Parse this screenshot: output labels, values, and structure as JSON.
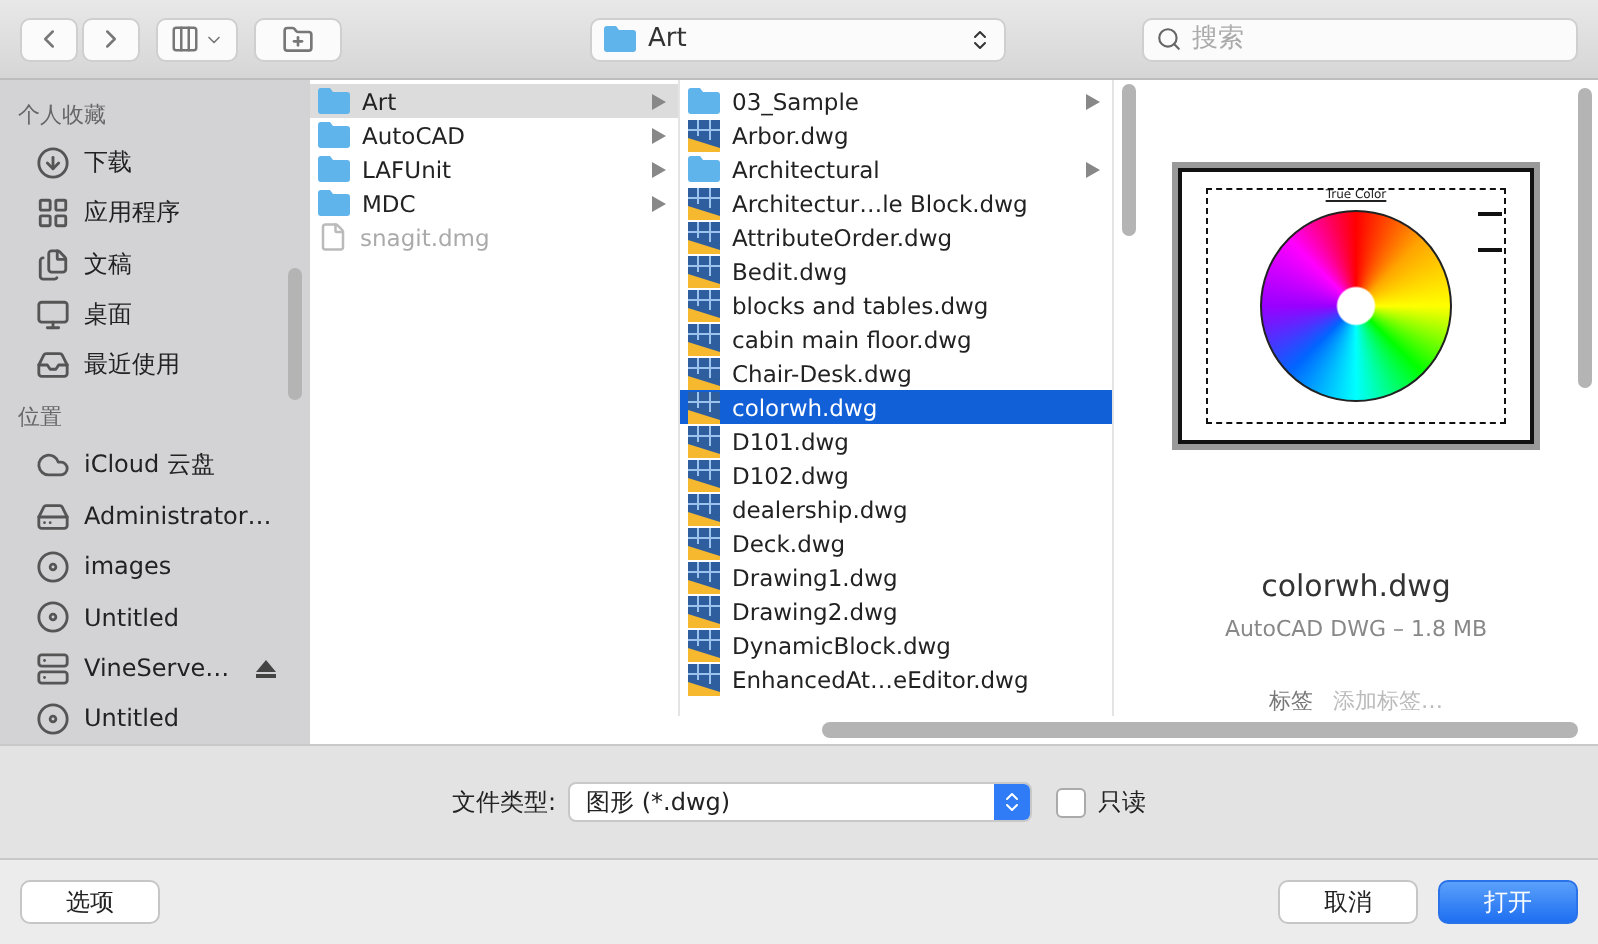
{
  "toolbar": {
    "path": "Art",
    "search": {
      "placeholder": "搜索"
    }
  },
  "sidebar": [
    {
      "heading": "个人收藏",
      "items": [
        {
          "label": "下载",
          "kind": "download",
          "ejectable": false
        },
        {
          "label": "应用程序",
          "kind": "apps",
          "ejectable": false
        },
        {
          "label": "文稿",
          "kind": "documents",
          "ejectable": false
        },
        {
          "label": "桌面",
          "kind": "desktop",
          "ejectable": false
        },
        {
          "label": "最近使用",
          "kind": "recents",
          "ejectable": false
        }
      ]
    },
    {
      "heading": "位置",
      "items": [
        {
          "label": "iCloud 云盘",
          "kind": "cloud",
          "ejectable": false
        },
        {
          "label": "Administrator…",
          "kind": "drive",
          "ejectable": false
        },
        {
          "label": "images",
          "kind": "disk",
          "ejectable": false
        },
        {
          "label": "Untitled",
          "kind": "disk",
          "ejectable": false
        },
        {
          "label": "VineServe…",
          "kind": "server",
          "ejectable": true
        },
        {
          "label": "Untitled",
          "kind": "disk",
          "ejectable": false
        }
      ]
    }
  ],
  "columns": [
    [
      {
        "name": "Art",
        "kind": "folder",
        "selected": true,
        "disabled": false
      },
      {
        "name": "AutoCAD",
        "kind": "folder",
        "selected": false,
        "disabled": false
      },
      {
        "name": "LAFUnit",
        "kind": "folder",
        "selected": false,
        "disabled": false
      },
      {
        "name": "MDC",
        "kind": "folder",
        "selected": false,
        "disabled": false
      },
      {
        "name": "snagit.dmg",
        "kind": "file",
        "selected": false,
        "disabled": true
      }
    ],
    [
      {
        "name": "03_Sample",
        "kind": "folder",
        "selected": false,
        "disabled": false
      },
      {
        "name": "Arbor.dwg",
        "kind": "dwg",
        "selected": false,
        "disabled": false
      },
      {
        "name": "Architectural",
        "kind": "folder",
        "selected": false,
        "disabled": false
      },
      {
        "name": "Architectur…le Block.dwg",
        "kind": "dwg",
        "selected": false,
        "disabled": false
      },
      {
        "name": "AttributeOrder.dwg",
        "kind": "dwg",
        "selected": false,
        "disabled": false
      },
      {
        "name": "Bedit.dwg",
        "kind": "dwg",
        "selected": false,
        "disabled": false
      },
      {
        "name": "blocks and tables.dwg",
        "kind": "dwg",
        "selected": false,
        "disabled": false
      },
      {
        "name": "cabin main floor.dwg",
        "kind": "dwg",
        "selected": false,
        "disabled": false
      },
      {
        "name": "Chair-Desk.dwg",
        "kind": "dwg",
        "selected": false,
        "disabled": false
      },
      {
        "name": "colorwh.dwg",
        "kind": "dwg",
        "selected": true,
        "disabled": false
      },
      {
        "name": "D101.dwg",
        "kind": "dwg",
        "selected": false,
        "disabled": false
      },
      {
        "name": "D102.dwg",
        "kind": "dwg",
        "selected": false,
        "disabled": false
      },
      {
        "name": "dealership.dwg",
        "kind": "dwg",
        "selected": false,
        "disabled": false
      },
      {
        "name": "Deck.dwg",
        "kind": "dwg",
        "selected": false,
        "disabled": false
      },
      {
        "name": "Drawing1.dwg",
        "kind": "dwg",
        "selected": false,
        "disabled": false
      },
      {
        "name": "Drawing2.dwg",
        "kind": "dwg",
        "selected": false,
        "disabled": false
      },
      {
        "name": "DynamicBlock.dwg",
        "kind": "dwg",
        "selected": false,
        "disabled": false
      },
      {
        "name": "EnhancedAt…eEditor.dwg",
        "kind": "dwg",
        "selected": false,
        "disabled": false
      }
    ]
  ],
  "preview": {
    "thumbnail_title": "True Color",
    "name": "colorwh.dwg",
    "info": "AutoCAD DWG – 1.8 MB",
    "tags_label": "标签",
    "tags_placeholder": "添加标签…"
  },
  "filter": {
    "label": "文件类型:",
    "value": "图形 (*.dwg)",
    "readonly": {
      "label": "只读",
      "checked": false
    }
  },
  "buttons": [
    {
      "label": "选项",
      "kind": "default"
    },
    {
      "label": "取消",
      "kind": "default"
    },
    {
      "label": "打开",
      "kind": "primary"
    }
  ]
}
